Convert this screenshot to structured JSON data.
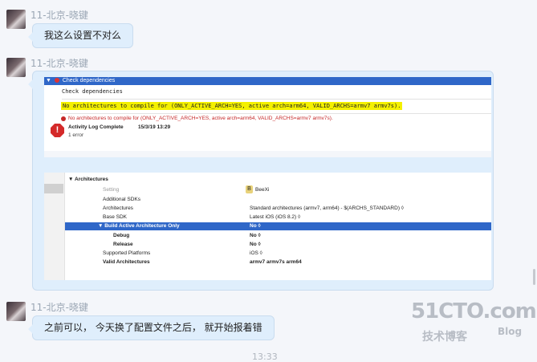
{
  "messages": [
    {
      "sender": "11-北京-晓键",
      "text": "我这么设置不对么"
    },
    {
      "sender": "11-北京-晓键"
    },
    {
      "sender": "11-北京-晓键",
      "text": "之前可以， 今天换了配置文件之后， 就开始报着错"
    }
  ],
  "screenshot": {
    "header": "Check dependencies",
    "subheader": "Check dependencies",
    "highlight_line": "No architectures to compile for (ONLY_ACTIVE_ARCH=YES, active arch=arm64, VALID_ARCHS=armv7 armv7s).",
    "error_line": "No architectures to compile for (ONLY_ACTIVE_ARCH=YES, active arch=arm64, VALID_ARCHS=armv7 armv7s).",
    "log_title": "Activity Log Complete",
    "log_time": "15/3/19 13:29",
    "log_count": "1 error",
    "section_title": "Architectures",
    "setting_header": "Setting",
    "target_name": "BeeXi",
    "settings": [
      {
        "name": "Additional SDKs",
        "value": ""
      },
      {
        "name": "Architectures",
        "value": "Standard architectures (armv7, arm64)  -  $(ARCHS_STANDARD) ◊"
      },
      {
        "name": "Base SDK",
        "value": "Latest iOS (iOS 8.2) ◊"
      },
      {
        "name": "▼ Build Active Architecture Only",
        "value": "No ◊",
        "selected": true
      },
      {
        "name": "Debug",
        "value": "No ◊",
        "indent": true
      },
      {
        "name": "Release",
        "value": "No ◊",
        "indent": true
      },
      {
        "name": "Supported Platforms",
        "value": "iOS ◊"
      },
      {
        "name": "Valid Architectures",
        "value": "armv7 armv7s arm64",
        "bold": true
      }
    ]
  },
  "timestamp": "13:33",
  "watermark": {
    "main": "51CTO.com",
    "sub": "技术博客",
    "blog": "Blog"
  },
  "colors": {
    "bubble": "#dfeefc",
    "accent": "#2f67c8",
    "error": "#c62828",
    "highlight": "#f4f000"
  }
}
